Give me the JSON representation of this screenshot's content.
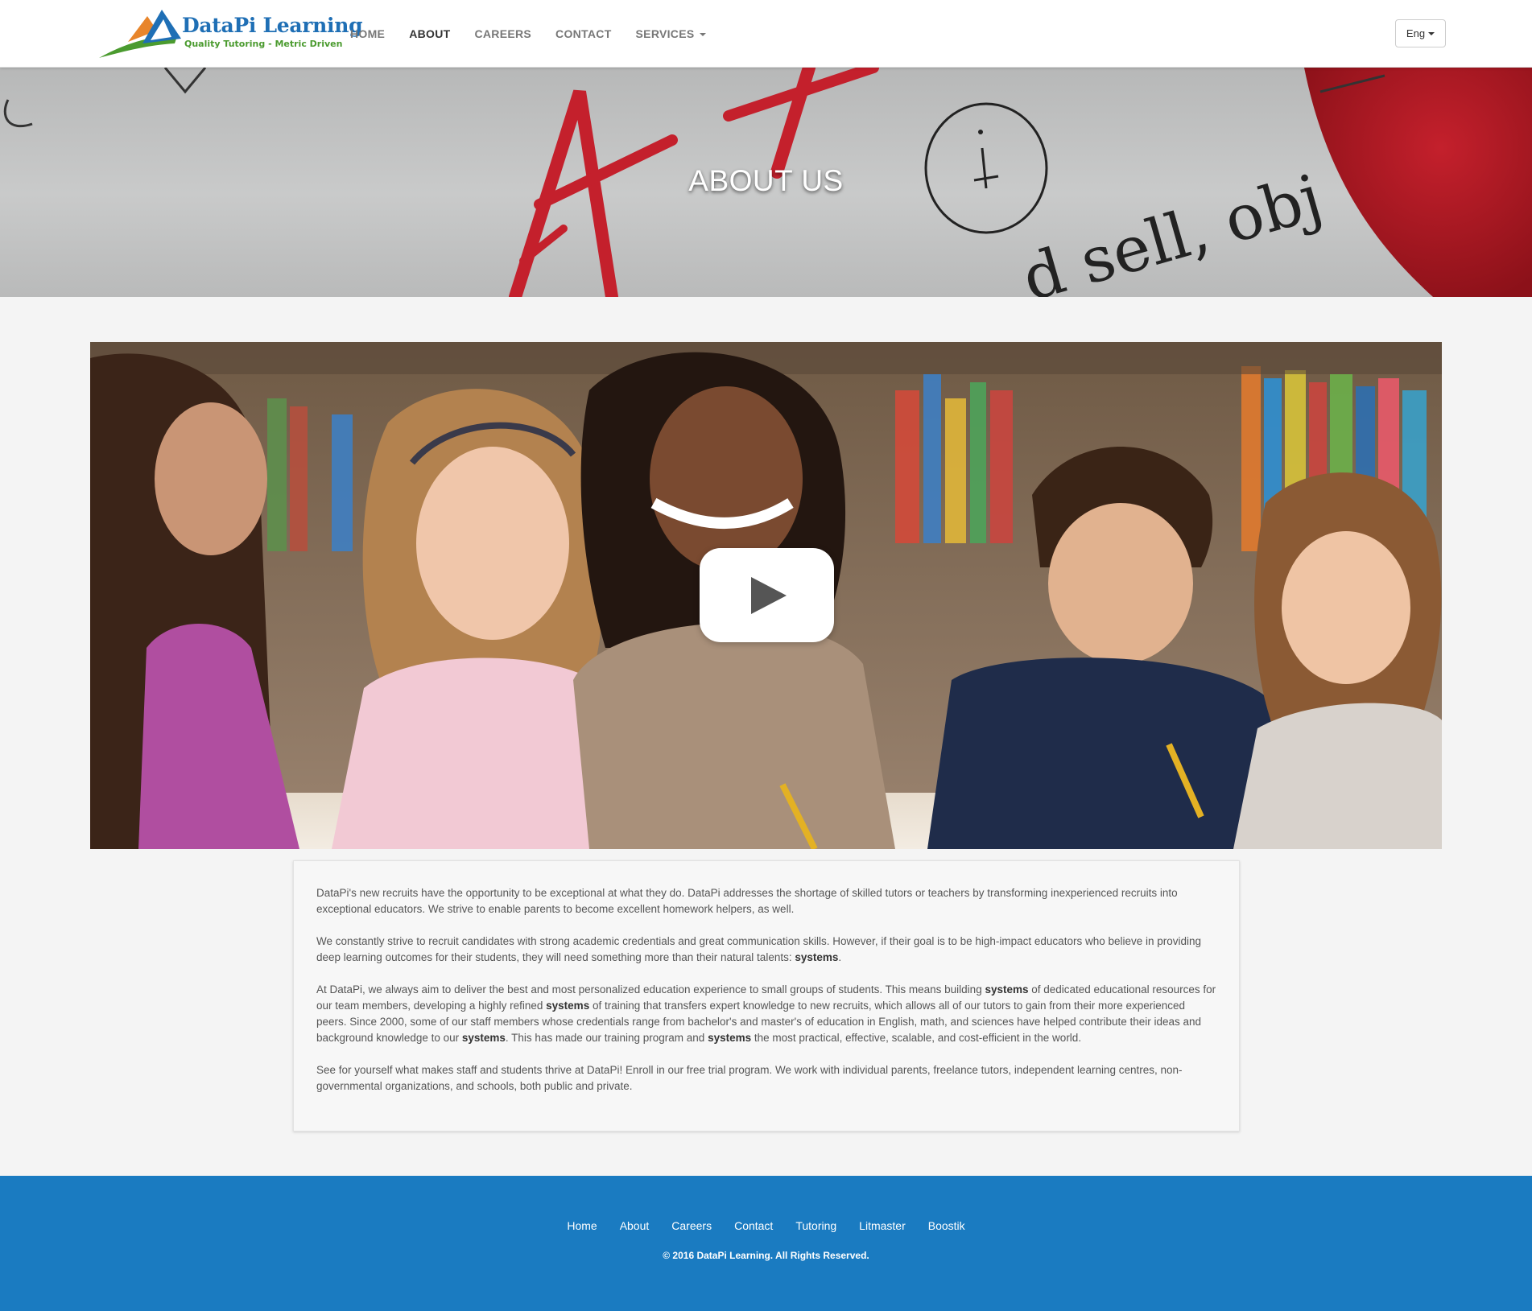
{
  "brand": {
    "name": "DataPi Learning",
    "tagline": "Quality Tutoring - Metric Driven"
  },
  "nav": {
    "items": [
      {
        "label": "HOME",
        "active": false
      },
      {
        "label": "ABOUT",
        "active": true
      },
      {
        "label": "CAREERS",
        "active": false
      },
      {
        "label": "CONTACT",
        "active": false
      },
      {
        "label": "SERVICES",
        "active": false,
        "dropdown": true
      }
    ],
    "language": "Eng"
  },
  "hero": {
    "title": "ABOUT US",
    "background_text": "d sell, obj"
  },
  "video": {
    "play_icon": "play-icon"
  },
  "about": {
    "p1": "DataPi's new recruits have the opportunity to be exceptional at what they do. DataPi addresses the shortage of skilled tutors or teachers by transforming inexperienced recruits into exceptional educators. We strive to enable parents to become excellent homework helpers, as well.",
    "p2_a": "We constantly strive to recruit candidates with strong academic credentials and great communication skills. However, if their goal is to be high-impact educators who believe in providing deep learning outcomes for their students, they will need something more than their natural talents: ",
    "p2_b": "systems",
    "p2_c": ".",
    "p3_a": "At DataPi, we always aim to deliver the best and most personalized education experience to small groups of students. This means building ",
    "p3_b": "systems",
    "p3_c": " of dedicated educational resources for our team members, developing a highly refined ",
    "p3_d": "systems",
    "p3_e": " of training that transfers expert knowledge to new recruits, which allows all of our tutors to gain from their more experienced peers. Since 2000, some of our staff members whose credentials range from bachelor's and master's of education in English, math, and sciences have helped contribute their ideas and background knowledge to our ",
    "p3_f": "systems",
    "p3_g": ". This has made our training program and ",
    "p3_h": "systems",
    "p3_i": " the most practical, effective, scalable, and cost-efficient in the world.",
    "p4": "See for yourself what makes staff and students thrive at DataPi! Enroll in our free trial program. We work with individual parents, freelance tutors, independent learning centres, non-governmental organizations, and schools, both public and private."
  },
  "footer": {
    "links": [
      "Home",
      "About",
      "Careers",
      "Contact",
      "Tutoring",
      "Litmaster",
      "Boostik"
    ],
    "copyright": "© 2016 DataPi Learning. All Rights Reserved."
  },
  "colors": {
    "footer_bg": "#1a7bc1",
    "brand_blue": "#1f6fb5",
    "brand_green": "#4b9b2f",
    "brand_orange": "#e8852b",
    "page_bg": "#f4f4f4"
  }
}
